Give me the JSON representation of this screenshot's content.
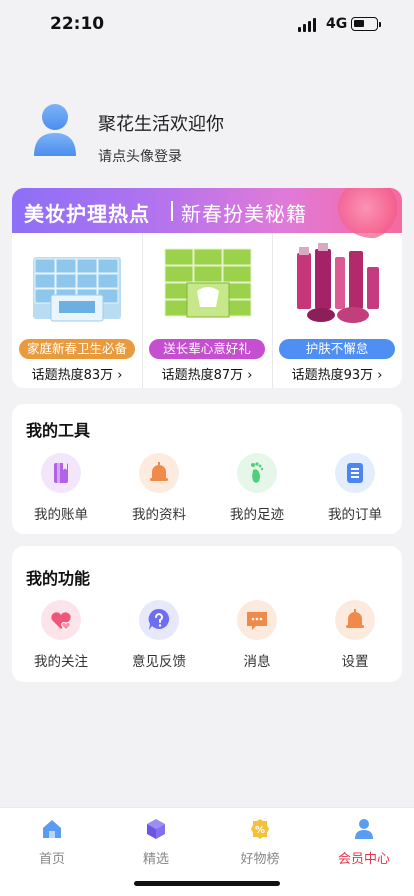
{
  "status": {
    "time": "22:10",
    "network": "4G"
  },
  "profile": {
    "welcome": "聚花生活欢迎你",
    "login_hint": "请点头像登录"
  },
  "banner": {
    "title": "美妆护理热点",
    "subtitle": "新春扮美秘籍",
    "products": [
      {
        "tag": "家庭新春卫生必备",
        "heat": "话题热度83万 ›",
        "color": "#e99a3c"
      },
      {
        "tag": "送长辈心意好礼",
        "heat": "话题热度87万 ›",
        "color": "#c54fd0"
      },
      {
        "tag": "护肤不懈怠",
        "heat": "话题热度93万 ›",
        "color": "#4f8ef2"
      }
    ]
  },
  "tools": {
    "title": "我的工具",
    "items": [
      {
        "label": "我的账单",
        "icon": "bill-icon",
        "bg": "#f3e6fb",
        "color": "#b063e6"
      },
      {
        "label": "我的资料",
        "icon": "bell-profile-icon",
        "bg": "#fdebe0",
        "color": "#f08a4b"
      },
      {
        "label": "我的足迹",
        "icon": "footprint-icon",
        "bg": "#e6f7ea",
        "color": "#4fcf7c"
      },
      {
        "label": "我的订单",
        "icon": "order-icon",
        "bg": "#e4edfb",
        "color": "#4d86ef"
      }
    ]
  },
  "functions": {
    "title": "我的功能",
    "items": [
      {
        "label": "我的关注",
        "icon": "hearts-icon",
        "bg": "#fde4ea",
        "color": "#f0557a"
      },
      {
        "label": "意见反馈",
        "icon": "question-icon",
        "bg": "#e8e8fb",
        "color": "#6d6ef0"
      },
      {
        "label": "消息",
        "icon": "message-icon",
        "bg": "#fdeadf",
        "color": "#f08a4b"
      },
      {
        "label": "设置",
        "icon": "bell-settings-icon",
        "bg": "#fdeadf",
        "color": "#f08a4b"
      }
    ]
  },
  "tabbar": {
    "tabs": [
      {
        "label": "首页",
        "icon": "home-icon"
      },
      {
        "label": "精选",
        "icon": "cube-icon"
      },
      {
        "label": "好物榜",
        "icon": "discount-badge-icon"
      },
      {
        "label": "会员中心",
        "icon": "user-icon",
        "active": true
      }
    ],
    "active_color": "#e5344a"
  }
}
